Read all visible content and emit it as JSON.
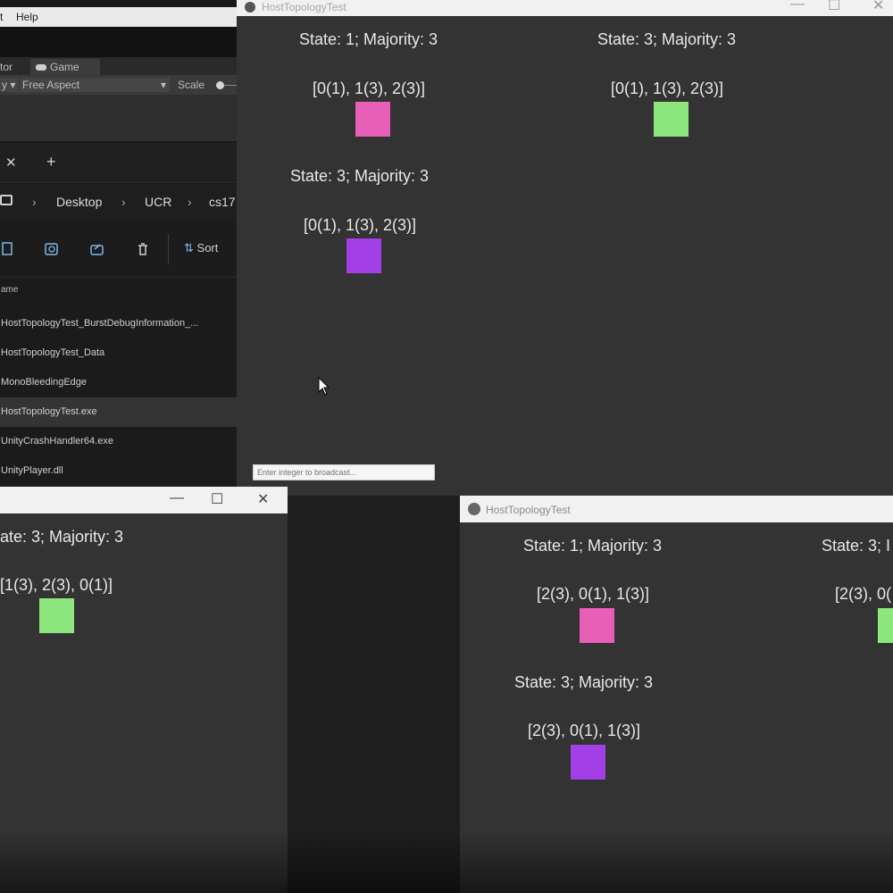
{
  "editor": {
    "menu": {
      "item_edit": "t",
      "item_help": "Help"
    },
    "tabs": {
      "inspector": "tor",
      "game": "Game"
    },
    "game_toolbar": {
      "display": "y",
      "aspect": "Free Aspect",
      "scale": "Scale"
    }
  },
  "explorer": {
    "tab_close": "✕",
    "tab_add": "+",
    "breadcrumb": [
      "Desktop",
      "UCR",
      "cs17"
    ],
    "toolbar": {
      "sort_label": "Sort"
    },
    "column_header": "ame",
    "files": [
      "HostTopologyTest_BurstDebugInformation_...",
      "HostTopologyTest_Data",
      "MonoBleedingEdge",
      "HostTopologyTest.exe",
      "UnityCrashHandler64.exe",
      "UnityPlayer.dll"
    ],
    "selected_index": 3
  },
  "window_top": {
    "title": "HostTopologyTest",
    "nodes": [
      {
        "state": "State: 1; Majority: 3",
        "list": "[0(1), 1(3), 2(3)]",
        "color": "#e75fb6"
      },
      {
        "state": "State: 3; Majority: 3",
        "list": "[0(1), 1(3), 2(3)]",
        "color": "#8ee77e"
      },
      {
        "state": "State: 3; Majority: 3",
        "list": "[0(1), 1(3), 2(3)]",
        "color": "#a23fe6"
      }
    ],
    "input_placeholder": "Enter integer to broadcast..."
  },
  "window_left": {
    "controls": {
      "minimize": "—",
      "maximize": "☐",
      "close": "✕"
    },
    "nodes": [
      {
        "state": "ate: 3; Majority: 3",
        "list": "[1(3), 2(3), 0(1)]",
        "color": "#8ee77e"
      }
    ]
  },
  "window_right": {
    "title": "HostTopologyTest",
    "nodes": [
      {
        "state": "State: 1; Majority: 3",
        "list": "[2(3), 0(1), 1(3)]",
        "color": "#e75fb6"
      },
      {
        "state": "State: 3; Majority: 3",
        "list": "[2(3), 0(1), 1(3)]",
        "color": "#a23fe6"
      },
      {
        "state": "State: 3; I",
        "list": "[2(3), 0(",
        "color": "#8ee77e"
      }
    ]
  },
  "icons": {
    "window_app": "unity-logo-icon",
    "cursor": "mouse-cursor-icon"
  }
}
